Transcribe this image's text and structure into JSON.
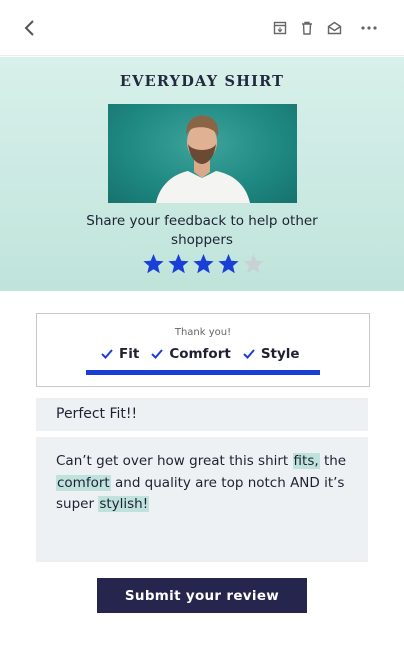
{
  "toolbar": {
    "icons": [
      "back-chevron-icon",
      "archive-icon",
      "trash-icon",
      "mail-icon",
      "more-icon"
    ]
  },
  "product": {
    "title": "EVERYDAY SHIRT",
    "image": "man-in-white-tshirt-photo"
  },
  "feedback": {
    "prompt": "Share your feedback to help other shoppers",
    "rating": 4,
    "max_rating": 5
  },
  "categories": {
    "thanks": "Thank you!",
    "chips": [
      {
        "label": "Fit",
        "checked": true
      },
      {
        "label": "Comfort",
        "checked": true
      },
      {
        "label": "Style",
        "checked": true
      }
    ],
    "progress_fraction": 1.0
  },
  "review": {
    "title": "Perfect Fit!!",
    "body_parts": [
      {
        "text": "Can’t get over how great this shirt ",
        "highlight": false
      },
      {
        "text": "fits,",
        "highlight": true
      },
      {
        "text": " the ",
        "highlight": false
      },
      {
        "text": "comfort",
        "highlight": true
      },
      {
        "text": " and quality are top notch AND it’s super ",
        "highlight": false
      },
      {
        "text": "stylish!",
        "highlight": true
      }
    ]
  },
  "submit": {
    "label": "Submit your review"
  },
  "colors": {
    "accent": "#1a3fd6",
    "hero_bg": "#c9e9e1",
    "field_bg": "#edf1f3",
    "highlight": "#bfe2dd",
    "submit_bg": "#25254d",
    "star_empty": "#c8d2d6"
  }
}
